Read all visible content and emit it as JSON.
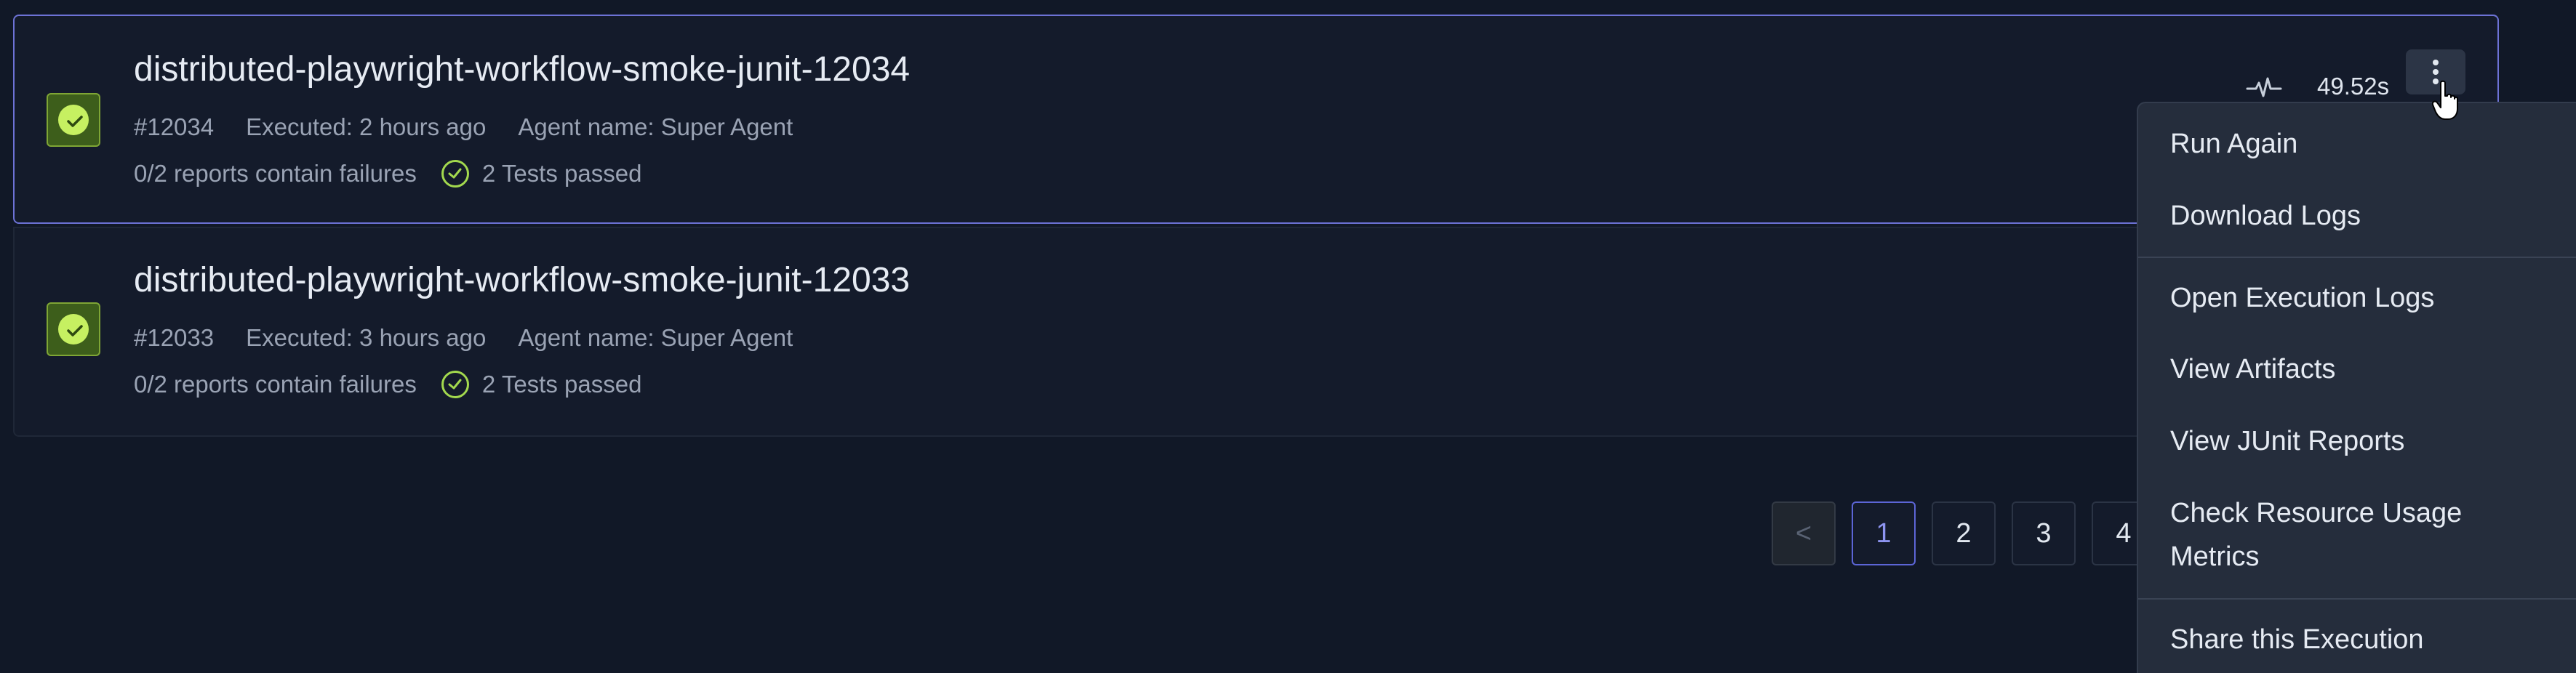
{
  "executions": [
    {
      "title": "distributed-playwright-workflow-smoke-junit-12034",
      "id": "#12034",
      "executed": "Executed: 2 hours ago",
      "agent": "Agent name: Super Agent",
      "failures": "0/2 reports contain failures",
      "tests": "2 Tests passed",
      "duration": "49.52s",
      "status": "passed"
    },
    {
      "title": "distributed-playwright-workflow-smoke-junit-12033",
      "id": "#12033",
      "executed": "Executed: 3 hours ago",
      "agent": "Agent name: Super Agent",
      "failures": "0/2 reports contain failures",
      "tests": "2 Tests passed",
      "status": "passed"
    }
  ],
  "pagination": {
    "prev_label": "<",
    "pages": [
      "1",
      "2",
      "3",
      "4"
    ],
    "current": "1"
  },
  "menu": {
    "items": [
      "Run Again",
      "Download Logs",
      "Open Execution Logs",
      "View Artifacts",
      "View JUnit Reports",
      "Check Resource Usage Metrics",
      "Share this Execution"
    ]
  },
  "colors": {
    "background": "#111827",
    "accent": "#6d72d6",
    "success": "#c6f061",
    "menu_bg": "#252d3c"
  },
  "icons": [
    "check-icon",
    "activity-icon",
    "more-vertical-icon",
    "pointer-cursor-icon"
  ]
}
